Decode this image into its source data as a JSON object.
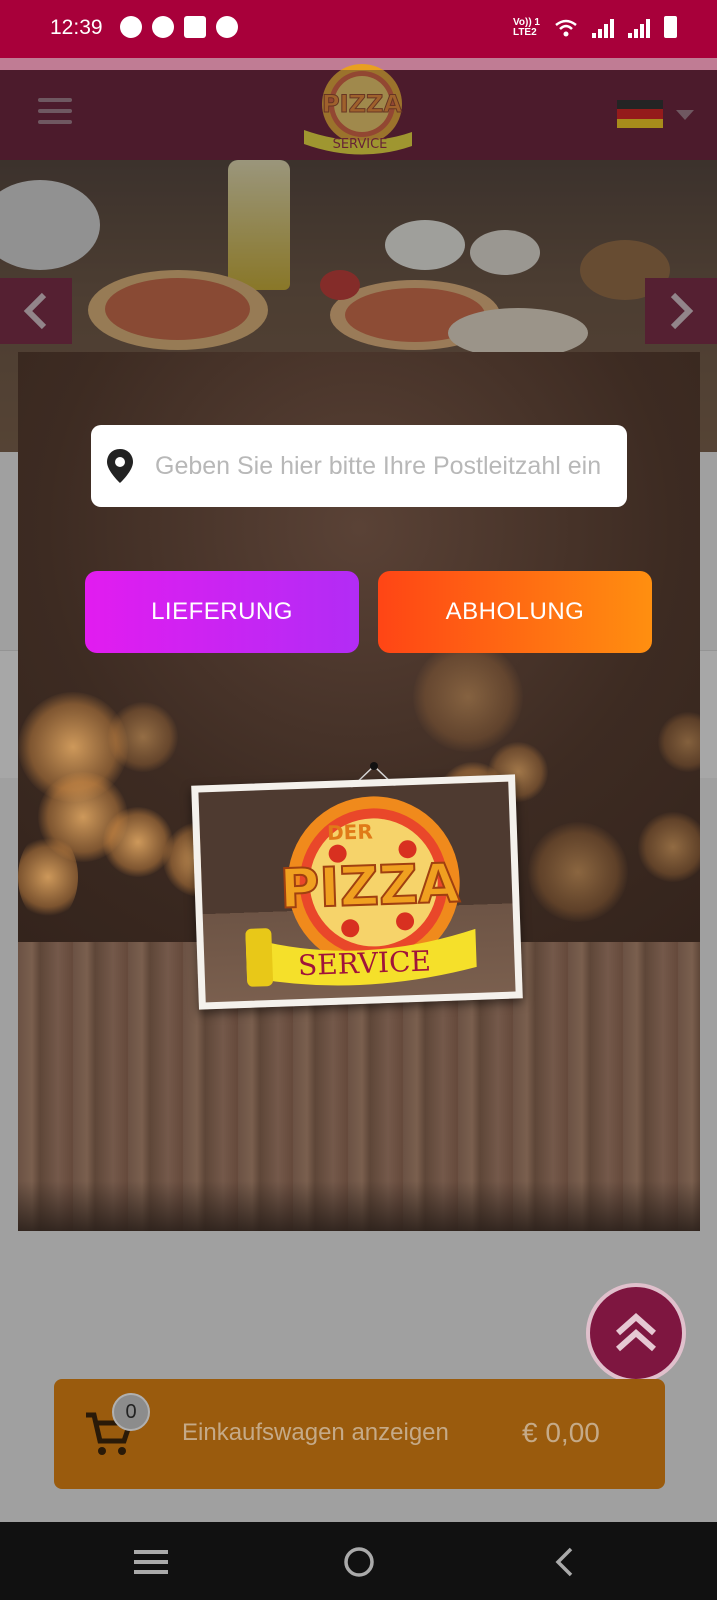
{
  "status_bar": {
    "time": "12:39",
    "network_label_1": "Vo)) 1",
    "network_label_2": "LTE2",
    "notification_icons": [
      "facebook-icon",
      "speedometer-icon",
      "mail-icon",
      "swirl-icon"
    ],
    "system_icons": [
      "wifi-icon",
      "signal-icon",
      "signal-icon",
      "battery-icon"
    ]
  },
  "header": {
    "menu_icon": "hamburger-icon",
    "logo_alt": "Der Pizza Service",
    "language": "Deutsch",
    "language_flag": "germany-flag-icon"
  },
  "hero": {
    "prev_icon": "chevron-left-icon",
    "next_icon": "chevron-right-icon"
  },
  "modal": {
    "postcode_placeholder": "Geben Sie hier bitte Ihre Postleitzahl ein",
    "location_icon": "map-pin-icon",
    "delivery_label": "LIEFERUNG",
    "pickup_label": "ABHOLUNG",
    "logo_line_1": "DER",
    "logo_line_2": "PIZZA",
    "logo_line_3": "SERVICE"
  },
  "fab": {
    "icon": "double-chevron-up-icon"
  },
  "cart": {
    "count": "0",
    "label": "Einkaufswagen anzeigen",
    "total": "€ 0,00",
    "icon": "shopping-cart-icon"
  },
  "navbar": {
    "icons": [
      "recent-apps-icon",
      "home-icon",
      "back-icon"
    ]
  },
  "colors": {
    "status_bar": "#a8003a",
    "header": "#5a0020",
    "delivery_button": "#d020f2",
    "pickup_button": "#ff6a12",
    "cart_bar": "#9a5b0d",
    "fab": "#7e1640"
  }
}
